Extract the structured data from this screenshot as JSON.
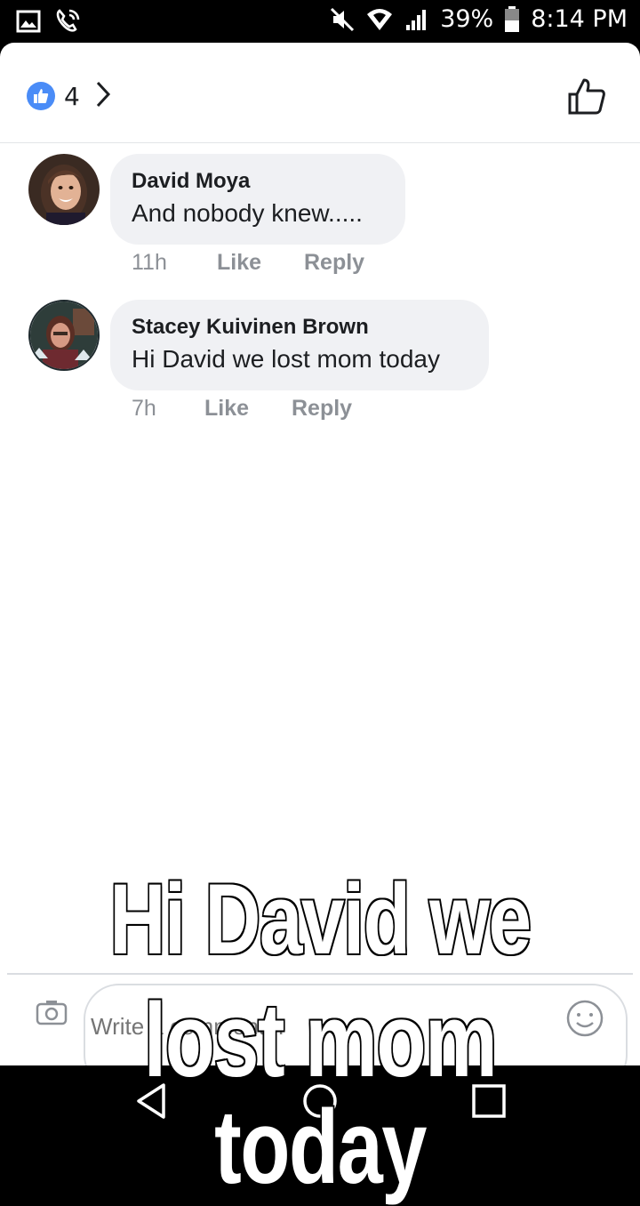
{
  "status_bar": {
    "battery": "39%",
    "time": "8:14 PM",
    "icons": [
      "gallery-icon",
      "wifi-calling-icon",
      "mute-icon",
      "wifi-icon",
      "signal-icon",
      "battery-icon"
    ]
  },
  "header": {
    "reaction_count": "4",
    "reaction_icon": "like-reaction-icon"
  },
  "comments": [
    {
      "author": "David Moya",
      "text": "And nobody knew.....",
      "time": "11h",
      "like_label": "Like",
      "reply_label": "Reply"
    },
    {
      "author": "Stacey Kuivinen Brown",
      "text": "Hi David we lost mom today",
      "time": "7h",
      "like_label": "Like",
      "reply_label": "Reply"
    }
  ],
  "composer": {
    "placeholder": "Write a comment..."
  },
  "caption": {
    "line1": "Hi David we",
    "line2": "lost mom today"
  },
  "colors": {
    "accent": "#4a8cf7",
    "bubble": "#f0f1f4",
    "meta": "#8c9096"
  }
}
